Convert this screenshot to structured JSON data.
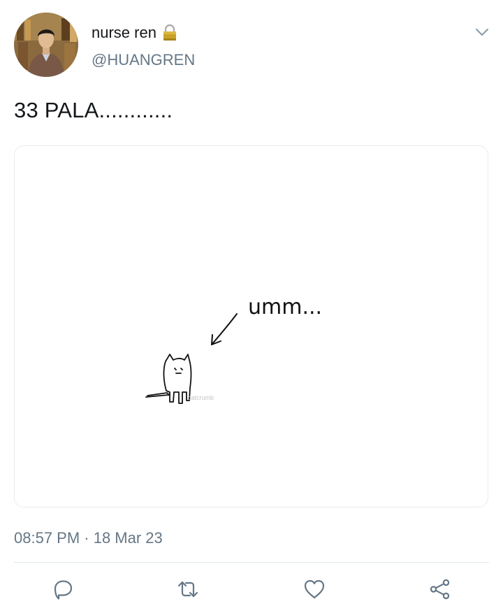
{
  "tweet": {
    "display_name": "nurse ren",
    "handle": "@HUANGREN",
    "text": "33 PALA............",
    "timestamp": "08:57 PM · 18 Mar 23"
  },
  "media": {
    "caption": "umm...",
    "watermark": "catcrumb"
  },
  "icons": {
    "header": [
      "lock-icon",
      "chevron-down-icon"
    ],
    "actions": [
      "reply-icon",
      "retweet-icon",
      "like-icon",
      "share-icon"
    ]
  },
  "colors": {
    "text_primary": "#14171a",
    "text_secondary": "#657786",
    "divider": "#e1e8ed",
    "icon": "#657786"
  }
}
